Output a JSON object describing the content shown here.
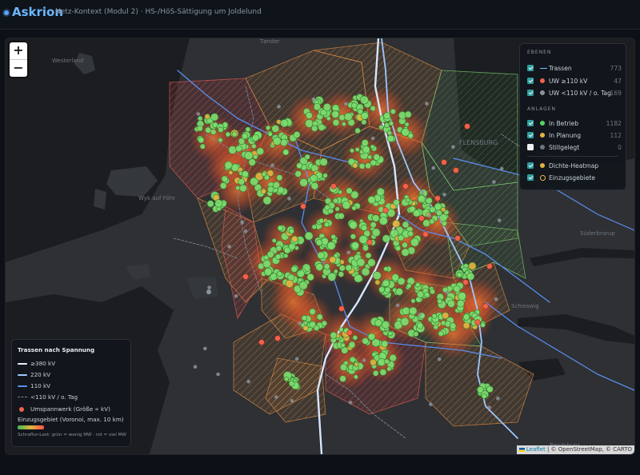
{
  "header": {
    "brand": "Askrion",
    "subtitle": "Netz-Kontext (Modul 2) · HS-/HöS-Sättigung um Joldelund"
  },
  "map": {
    "zoom_in": "+",
    "zoom_out": "−",
    "places": [
      "Westerland",
      "Tønder",
      "Wyk auf Föhr",
      "Süderbrarup",
      "Schleswig",
      "Rendsburg",
      "FLENSBURG"
    ],
    "attribution": {
      "leaflet": "Leaflet",
      "rest": " | © OpenStreetMap, © CARTO"
    }
  },
  "layers_panel": {
    "section_layers": "EBENEN",
    "layers": [
      {
        "label": "Trassen",
        "count": "773",
        "checked": true,
        "symbol": "line",
        "color": "#79c0ff"
      },
      {
        "label": "UW ≥110 kV",
        "count": "47",
        "checked": true,
        "symbol": "dot",
        "color": "#f0634a"
      },
      {
        "label": "UW <110 kV / o. Tag",
        "count": "169",
        "checked": true,
        "symbol": "dot",
        "color": "#8b949e"
      }
    ],
    "section_plants": "ANLAGEN",
    "plants": [
      {
        "label": "In Betrieb",
        "count": "1182",
        "checked": true,
        "color": "#56d364"
      },
      {
        "label": "In Planung",
        "count": "112",
        "checked": true,
        "color": "#e3b341"
      },
      {
        "label": "Stillgelegt",
        "count": "0",
        "checked": false,
        "color": "#6e7681"
      }
    ],
    "overlays": [
      {
        "label": "Dichte-Heatmap",
        "checked": true,
        "symbol": "dot",
        "color": "#e3b341"
      },
      {
        "label": "Einzugsgebiete",
        "checked": true,
        "symbol": "ring",
        "color": "#f2b84b"
      }
    ]
  },
  "legend": {
    "title": "Trassen nach Spannung",
    "lines": [
      {
        "label": "≥380 kV",
        "color": "#e6f0ff",
        "style": "solid"
      },
      {
        "label": "220 kV",
        "color": "#9ec8ff",
        "style": "solid"
      },
      {
        "label": "110 kV",
        "color": "#5b8def",
        "style": "solid"
      },
      {
        "label": "<110 kV / o. Tag",
        "color": "#7d8590",
        "style": "dashed"
      }
    ],
    "substation_label": "Umspannwerk (Größe ∝ kV)",
    "catchment_label": "Einzugsgebiet (Voronoi, max. 10 km)",
    "hatch_note": "Schraffur-Last: grün = wenig MW · rot = viel MW"
  }
}
